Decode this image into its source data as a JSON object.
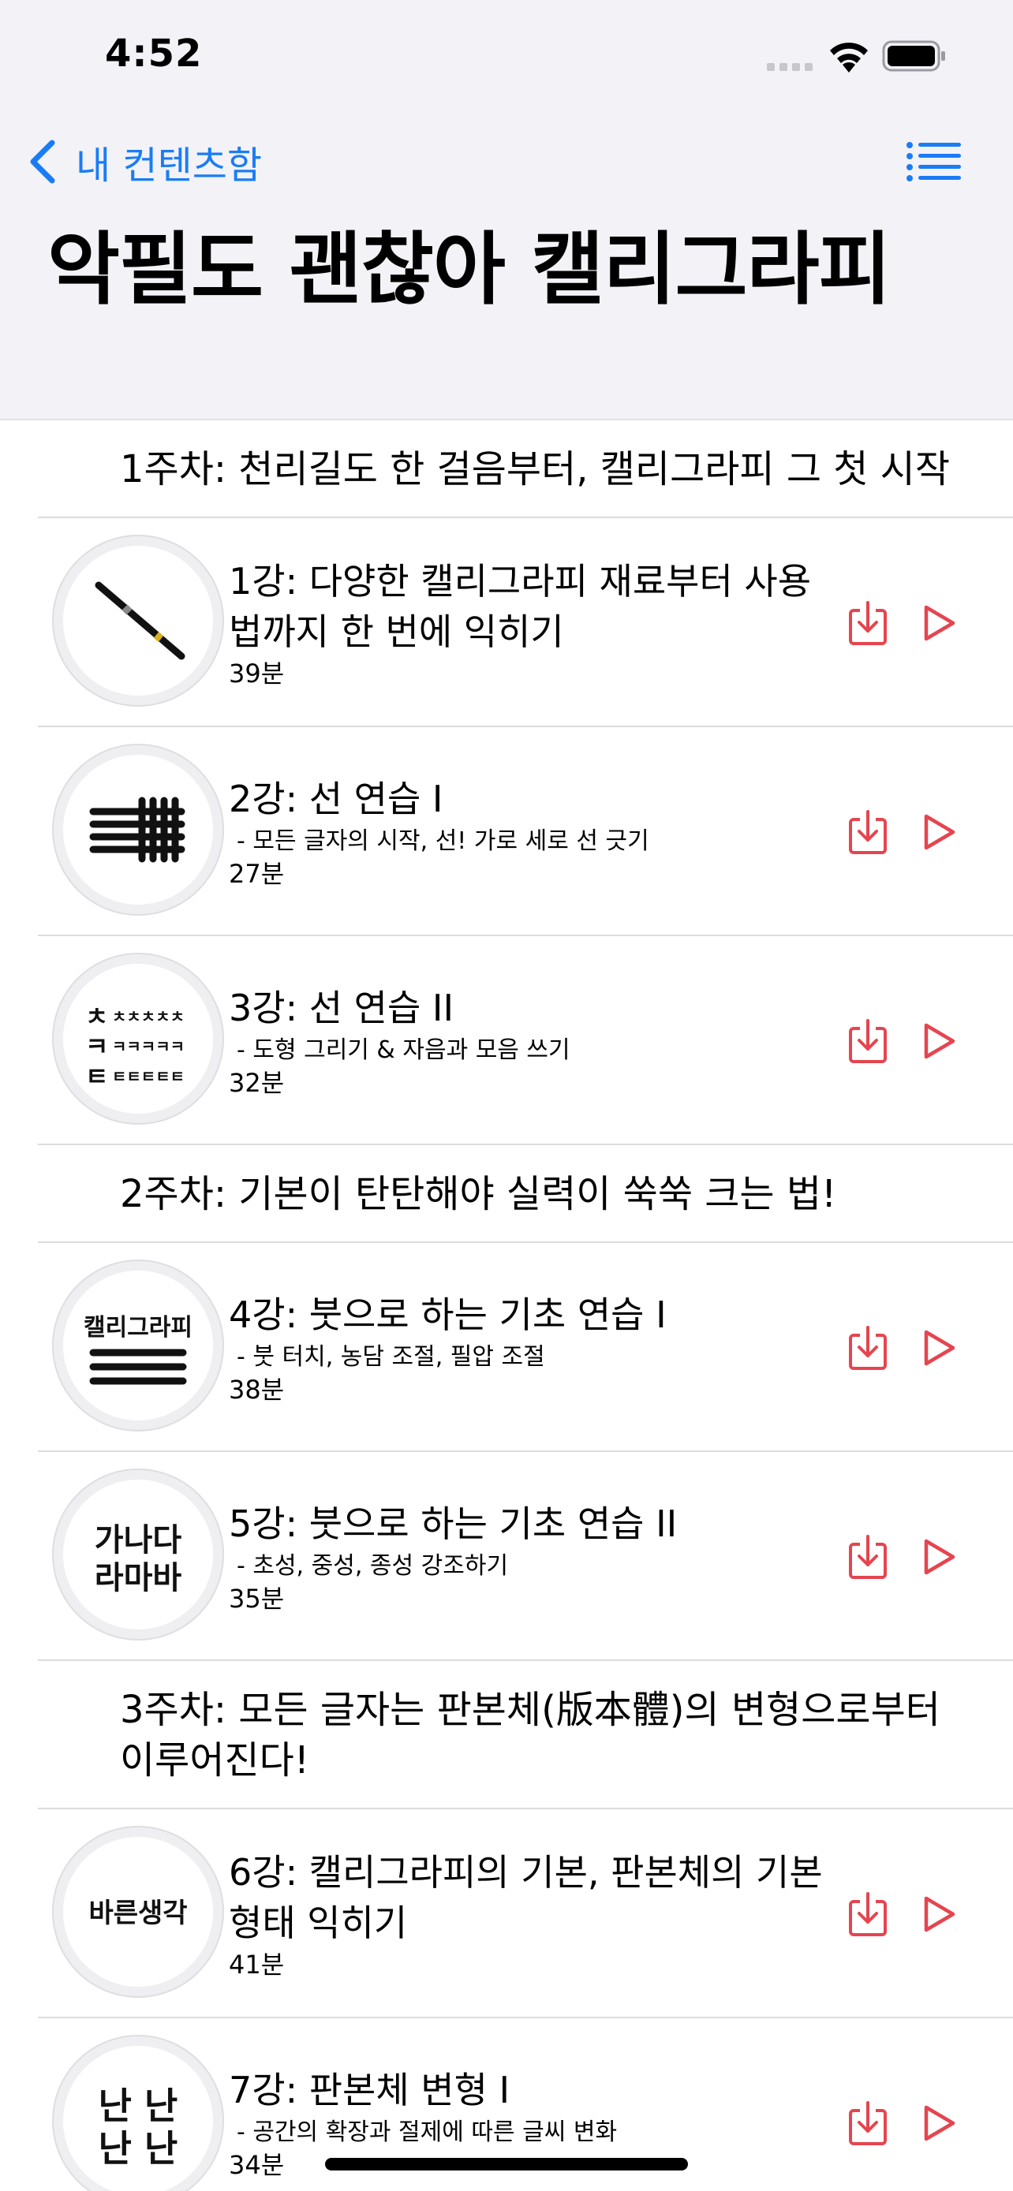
{
  "status_bar": {
    "time": "4:52"
  },
  "nav": {
    "back_label": "내 컨텐츠함",
    "title": "악필도 괜찮아 캘리그라피"
  },
  "colors": {
    "accent_blue": "#1a7cf5",
    "action_red": "#e5454f",
    "header_bg": "#f2f2f7"
  },
  "icons": {
    "back": "chevron-left-icon",
    "menu": "list-menu-icon",
    "download": "download-icon",
    "play": "play-icon"
  },
  "weeks": [
    {
      "header": "1주차: 천리길도 한 걸음부터, 캘리그라피 그 첫 시작",
      "lessons": [
        {
          "title": "1강: 다양한 캘리그라피 재료부터 사용법까지 한 번에 익히기",
          "subtitle": "",
          "duration": "39분",
          "thumb": "brush-pen"
        },
        {
          "title": "2강: 선 연습 I",
          "subtitle": "- 모든 글자의 시작, 선! 가로 세로 선 긋기",
          "duration": "27분",
          "thumb": "line-grid"
        },
        {
          "title": "3강: 선 연습 II",
          "subtitle": "- 도형 그리기 & 자음과 모음 쓰기",
          "duration": "32분",
          "thumb": "consonants"
        }
      ]
    },
    {
      "header": "2주차: 기본이 탄탄해야 실력이 쑥쑥 크는 법!",
      "lessons": [
        {
          "title": "4강: 붓으로 하는 기초 연습 I",
          "subtitle": "- 붓 터치, 농담 조절, 필압 조절",
          "duration": "38분",
          "thumb": "calligraphy-word",
          "thumb_text": "캘리그라피"
        },
        {
          "title": "5강: 붓으로 하는 기초 연습 II",
          "subtitle": "- 초성, 중성, 종성 강조하기",
          "duration": "35분",
          "thumb": "ganada",
          "thumb_text": [
            "가나다",
            "라마바"
          ]
        }
      ]
    },
    {
      "header": "3주차: 모든 글자는 판본체(版本體)의 변형으로부터 이루어진다!",
      "lessons": [
        {
          "title": "6강: 캘리그라피의 기본, 판본체의 기본 형태 익히기",
          "subtitle": "",
          "duration": "41분",
          "thumb": "bareun",
          "thumb_text": "바른생각"
        },
        {
          "title": "7강: 판본체 변형 I",
          "subtitle": "- 공간의 확장과 절제에 따른 글씨 변화",
          "duration": "34분",
          "thumb": "nan",
          "thumb_text": [
            "난 난",
            "난 난"
          ]
        }
      ]
    }
  ]
}
